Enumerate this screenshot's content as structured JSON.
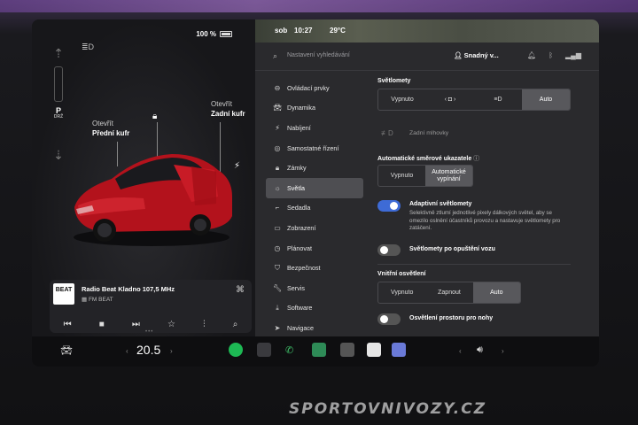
{
  "status": {
    "battery": "100 %",
    "time": "10:27",
    "temperature": "29°C",
    "mode": "sob"
  },
  "left": {
    "gear": "P",
    "gear_sub": "DRŽ",
    "front_trunk_label": "Otevřít",
    "front_trunk_name": "Přední kufr",
    "rear_trunk_label": "Otevřít",
    "rear_trunk_name": "Zadní kufr"
  },
  "media": {
    "logo": "BEAT",
    "station": "Radio Beat Kladno 107,5 MHz",
    "source": "FM BEAT"
  },
  "search": {
    "placeholder": "Nastavení vyhledávání"
  },
  "user": {
    "name": "Snadný v..."
  },
  "menu": {
    "items": [
      {
        "label": "Ovládací prvky",
        "icon": "toggle-icon"
      },
      {
        "label": "Dynamika",
        "icon": "car-icon"
      },
      {
        "label": "Nabíjení",
        "icon": "bolt-icon"
      },
      {
        "label": "Samostatné řízení",
        "icon": "steering-icon"
      },
      {
        "label": "Zámky",
        "icon": "lock-icon"
      },
      {
        "label": "Světla",
        "icon": "light-icon"
      },
      {
        "label": "Sedadla",
        "icon": "seat-icon"
      },
      {
        "label": "Zobrazení",
        "icon": "display-icon"
      },
      {
        "label": "Plánovat",
        "icon": "clock-icon"
      },
      {
        "label": "Bezpečnost",
        "icon": "shield-icon"
      },
      {
        "label": "Servis",
        "icon": "wrench-icon"
      },
      {
        "label": "Software",
        "icon": "download-icon"
      },
      {
        "label": "Navigace",
        "icon": "nav-icon"
      }
    ],
    "active_index": 5
  },
  "lights": {
    "headlights_title": "Světlomety",
    "headlights_options": [
      "Vypnuto",
      "",
      "",
      "Auto"
    ],
    "headlights_selected": 3,
    "rear_fog": "Zadní mlhovky",
    "indicators_title": "Automatické směrové ukazatele",
    "indicators_options": [
      "Vypnuto",
      "Automatické vypínání"
    ],
    "indicators_selected": 1,
    "adaptive_title": "Adaptivní světlomety",
    "adaptive_desc": "Selektivně ztlumí jednotlivé pixely dálkových světel, aby se omezilo oslnění účastníků provozu a nastavuje světlomety pro zatáčení.",
    "adaptive_on": true,
    "exit_title": "Světlomety po opuštění vozu",
    "exit_on": false,
    "interior_title": "Vnitřní osvětlení",
    "interior_options": [
      "Vypnuto",
      "Zapnout",
      "Auto"
    ],
    "interior_selected": 2,
    "footwell_title": "Osvětlení prostoru pro nohy",
    "footwell_on": false
  },
  "dock": {
    "temperature": "20.5"
  },
  "watermark": "SPORTOVNIVOZY.CZ"
}
